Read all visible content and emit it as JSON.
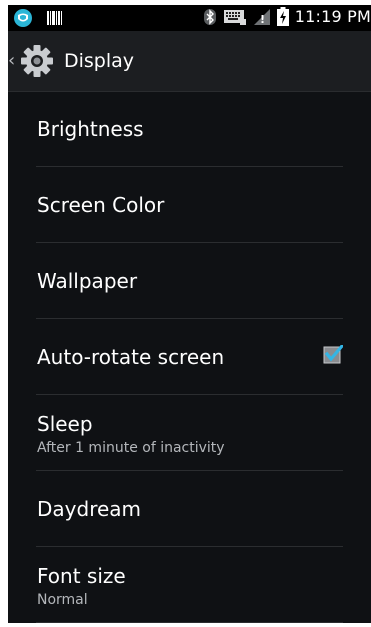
{
  "status_bar": {
    "time": "11:19 PM",
    "icons": [
      "app-shield-icon",
      "barcode-icon",
      "bluetooth-icon",
      "keyboard-icon",
      "no-signal-icon",
      "battery-charging-icon"
    ]
  },
  "action_bar": {
    "title": "Display",
    "icon": "settings-gear-icon"
  },
  "settings": [
    {
      "label": "Brightness"
    },
    {
      "label": "Screen Color"
    },
    {
      "label": "Wallpaper"
    },
    {
      "label": "Auto-rotate screen",
      "checked": true
    },
    {
      "label": "Sleep",
      "summary": "After 1 minute of inactivity"
    },
    {
      "label": "Daydream"
    },
    {
      "label": "Font size",
      "summary": "Normal"
    }
  ],
  "colors": {
    "background": "#0f1114",
    "action_bar": "#1c1e21",
    "accent": "#33b5e5",
    "divider": "#2b2d30"
  }
}
